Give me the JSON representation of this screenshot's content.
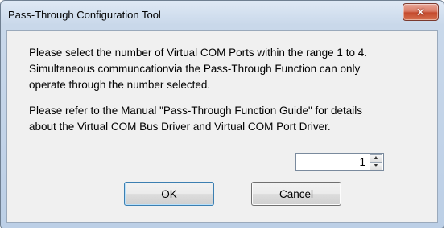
{
  "window": {
    "title": "Pass-Through Configuration Tool",
    "close_glyph": "✕"
  },
  "message": {
    "paragraph1": [
      "Please select the number of Virtual COM Ports within the range 1 to 4.",
      "Simultaneous communcationvia the Pass-Through Function can only",
      "operate through the number selected."
    ],
    "paragraph2": [
      "Please refer to the Manual \"Pass-Through Function Guide\" for details",
      "about the Virtual COM Bus Driver and Virtual COM Port Driver."
    ]
  },
  "spinner": {
    "value": "1",
    "up_glyph": "▲",
    "down_glyph": "▼"
  },
  "buttons": {
    "ok_label": "OK",
    "cancel_label": "Cancel"
  },
  "icons": {
    "close": "close-icon",
    "spin_up": "spin-up-icon",
    "spin_down": "spin-down-icon"
  }
}
